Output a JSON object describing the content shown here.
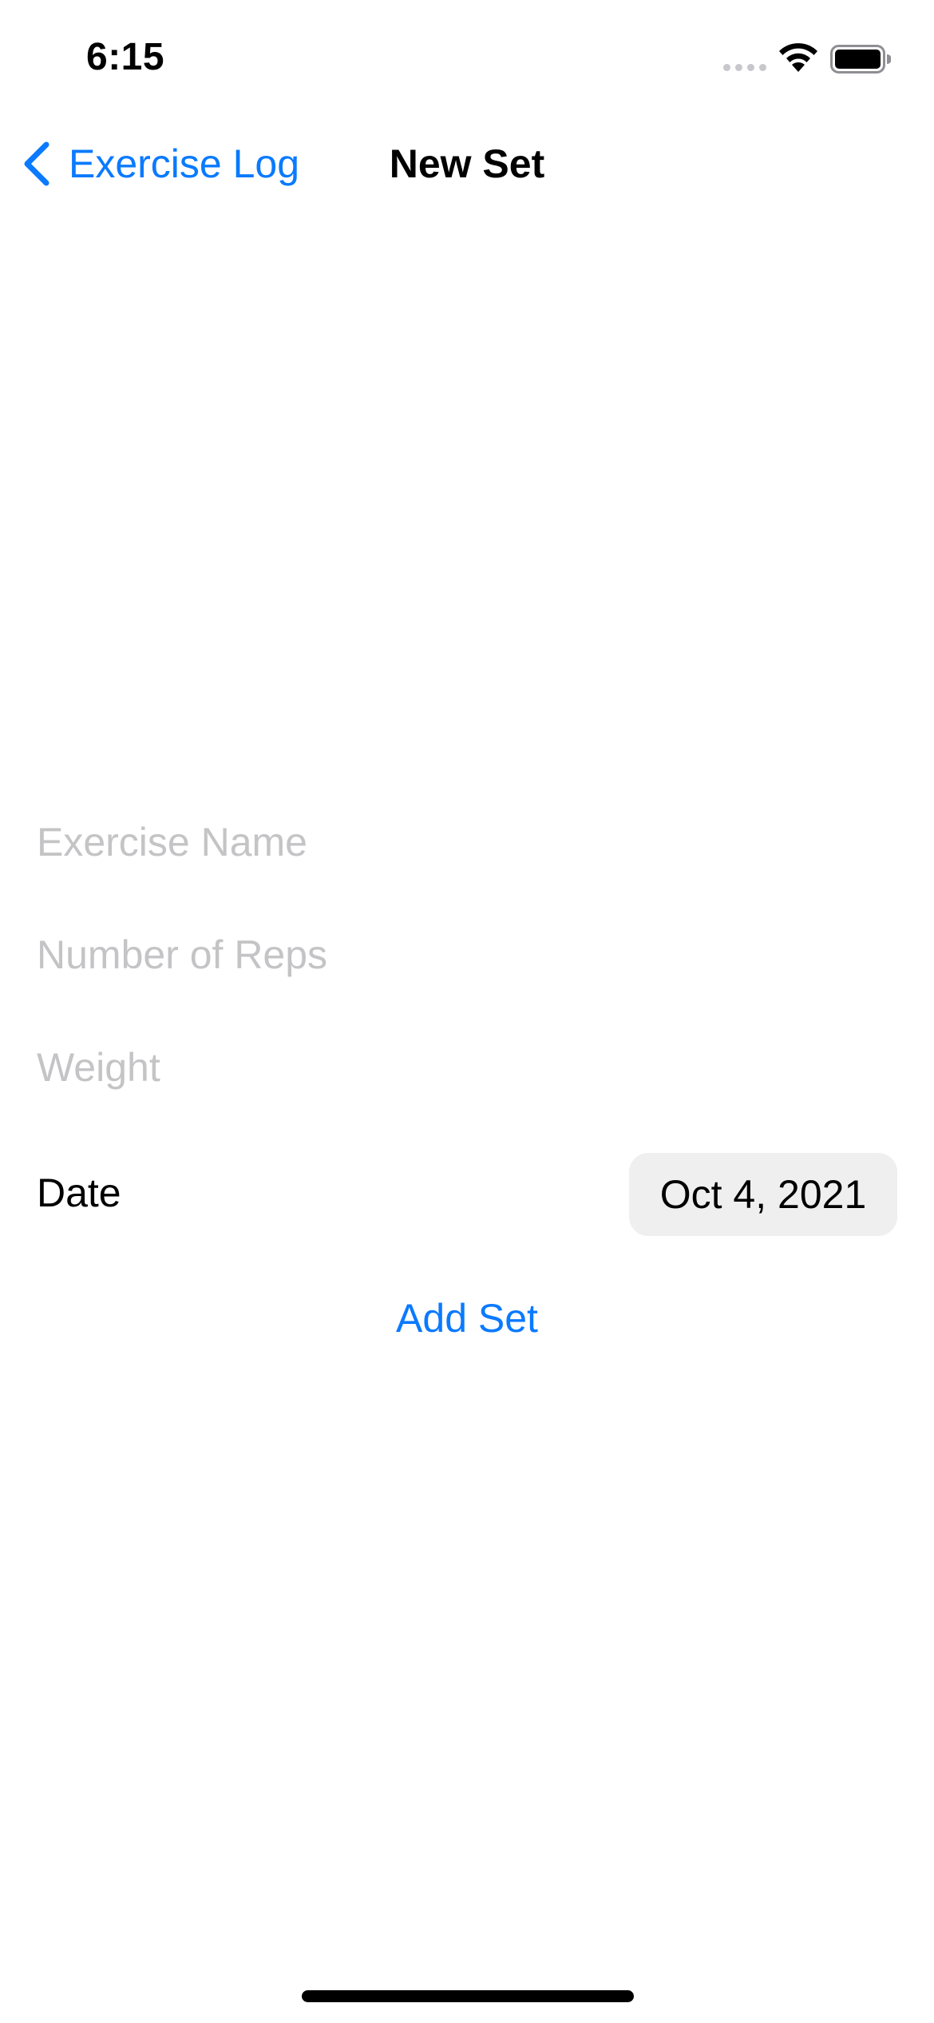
{
  "status_bar": {
    "time": "6:15",
    "signal_icon": "cellular-signal-icon",
    "wifi_icon": "wifi-icon",
    "battery_icon": "battery-icon"
  },
  "nav": {
    "back_label": "Exercise Log",
    "back_icon": "chevron-left-icon",
    "title": "New Set"
  },
  "form": {
    "exercise_name": {
      "value": "",
      "placeholder": "Exercise Name"
    },
    "reps": {
      "value": "",
      "placeholder": "Number of Reps"
    },
    "weight": {
      "value": "",
      "placeholder": "Weight"
    },
    "date_label": "Date",
    "date_value": "Oct 4, 2021",
    "add_button_label": "Add Set"
  },
  "colors": {
    "accent": "#0A7AFF",
    "placeholder": "#C4C4C6",
    "date_pill_bg": "#EFEFEF"
  }
}
